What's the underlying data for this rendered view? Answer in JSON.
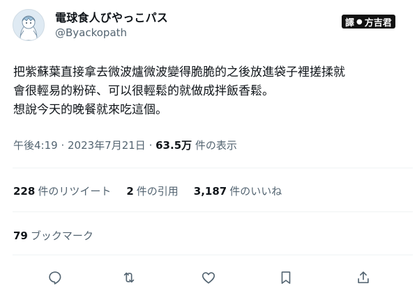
{
  "author": {
    "display_name": "電球食人びやっこパス",
    "handle": "@Byackopath"
  },
  "translator_badge": {
    "prefix": "譯",
    "separator": "●",
    "name": "方吉君"
  },
  "tweet": {
    "lines": [
      "把紫蘇葉直接拿去微波爐微波變得脆脆的之後放進袋子裡搓揉就",
      "會很輕易的粉碎、可以很輕鬆的就做成拌飯香鬆。",
      "想說今天的晚餐就來吃這個。"
    ]
  },
  "meta": {
    "time": "午後4:19",
    "sep1": " · ",
    "date": "2023年7月21日",
    "sep2": " · ",
    "views": "63.5万",
    "views_label": " 件の表示"
  },
  "stats": {
    "retweets": "228",
    "retweets_label": "件のリツイート",
    "quotes": "2",
    "quotes_label": "件の引用",
    "likes": "3,187",
    "likes_label": "件のいいね"
  },
  "bookmarks": {
    "count": "79",
    "label": "ブックマーク"
  },
  "actions": [
    "reply-icon",
    "retweet-icon",
    "like-icon",
    "bookmark-icon",
    "share-icon"
  ],
  "colors": {
    "text": "#0f1419",
    "secondary": "#536471",
    "divider": "#eff3f4",
    "badge_bg": "#111111"
  }
}
